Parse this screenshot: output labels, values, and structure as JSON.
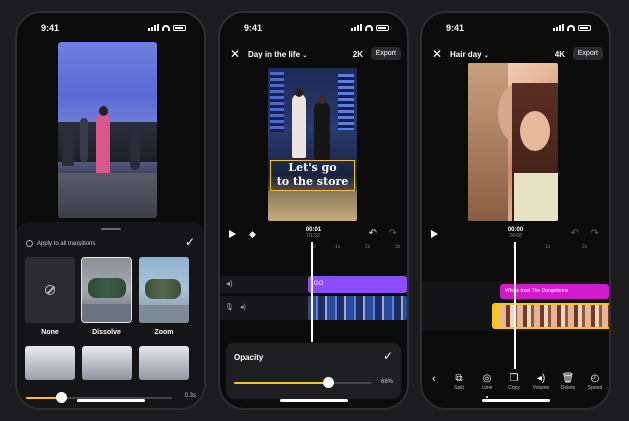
{
  "status_time": "9:41",
  "phone1": {
    "apply_all_label": "Apply to all transitions",
    "transitions": [
      {
        "name": "None",
        "icon": "none-icon"
      },
      {
        "name": "Dissolve",
        "icon": "dissolve-thumbnail"
      },
      {
        "name": "Zoom",
        "icon": "zoom-thumbnail"
      }
    ],
    "duration_value": "0.3s",
    "duration_level": 0.24
  },
  "phone2": {
    "project_title": "Day in the life",
    "resolution": "2K",
    "export_label": "Export",
    "overlay_text_1": "Let's go",
    "overlay_text_2": "to the store",
    "timecode_current": "00:01",
    "timecode_total": "01:32",
    "ruler_ticks": [
      "0",
      "1s",
      "2s",
      "3s"
    ],
    "text_clip_label": "GO",
    "opacity_label": "Opacity",
    "opacity_value": "68%",
    "opacity_level": 0.68
  },
  "phone3": {
    "project_title": "Hair day",
    "resolution": "4K",
    "export_label": "Export",
    "timecode_current": "00:00",
    "timecode_total": "24:68",
    "ruler_ticks": [
      "0",
      "1s",
      "2s"
    ],
    "music_clip_label": "Whole trust The Dongeleons",
    "tools": [
      {
        "label": "Split",
        "icon": "split-icon"
      },
      {
        "label": "Lime",
        "icon": "lime-icon"
      },
      {
        "label": "Copy",
        "icon": "copy-icon"
      },
      {
        "label": "Volume",
        "icon": "volume-icon"
      },
      {
        "label": "Delete",
        "icon": "delete-icon"
      },
      {
        "label": "Speed",
        "icon": "speed-icon"
      }
    ]
  },
  "colors": {
    "accent_yellow": "#f5c623",
    "text_purple": "#8b4dff",
    "music_pink": "#d11ac9",
    "clip_blue": "#3b6fd8"
  }
}
